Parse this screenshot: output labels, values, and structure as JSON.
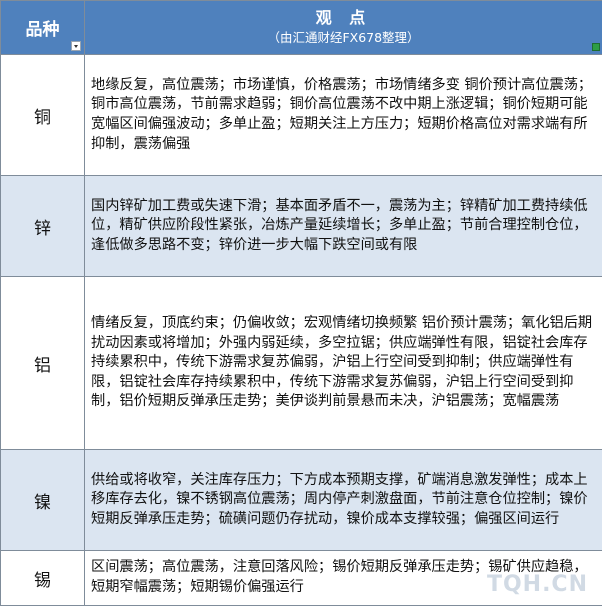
{
  "header": {
    "col1": "品种",
    "col2_title": "观 点",
    "col2_sub": "（由汇通财经FX678整理）"
  },
  "rows": [
    {
      "name": "铜",
      "text": "地缘反复，高位震荡；市场谨慎，价格震荡；市场情绪多变 铜价预计高位震荡；铜市高位震荡，节前需求趋弱；铜价高位震荡不改中期上涨逻辑；铜价短期可能宽幅区间偏强波动；多单止盈；短期关注上方压力；短期价格高位对需求端有所抑制，震荡偏强"
    },
    {
      "name": "锌",
      "text": "国内锌矿加工费或失速下滑；基本面矛盾不一，震荡为主；锌精矿加工费持续低位，精矿供应阶段性紧张，冶炼产量延续增长；多单止盈；节前合理控制仓位，逢低做多思路不变；锌价进一步大幅下跌空间或有限"
    },
    {
      "name": "铝",
      "text": "情绪反复，顶底约束；仍偏收敛；宏观情绪切换频繁 铝价预计震荡；氧化铝后期扰动因素或将增加；外强内弱延续，多空拉锯；供应端弹性有限，铝锭社会库存持续累积中，传统下游需求复苏偏弱，沪铝上行空间受到抑制；供应端弹性有限，铝锭社会库存持续累积中，传统下游需求复苏偏弱，沪铝上行空间受到抑制，铝价短期反弹承压走势；美伊谈判前景悬而未决，沪铝震荡；宽幅震荡"
    },
    {
      "name": "镍",
      "text": "供给或将收窄，关注库存压力；下方成本预期支撑，矿端消息激发弹性；成本上移库存去化，镍不锈钢高位震荡；周内停产刺激盘面，节前注意仓位控制；镍价短期反弹承压走势；硫磺问题仍存扰动，镍价成本支撑较强；偏强区间运行"
    },
    {
      "name": "锡",
      "text": "区间震荡；高位震荡，注意回落风险；锡价短期反弹承压走势；锡矿供应趋稳，短期窄幅震荡；短期锡价偏强运行"
    }
  ],
  "watermark": "TQH.CN",
  "colors": {
    "header_bg": "#4f81bd",
    "band_bg": "#dbe5f1",
    "border": "#7f8c9a"
  }
}
